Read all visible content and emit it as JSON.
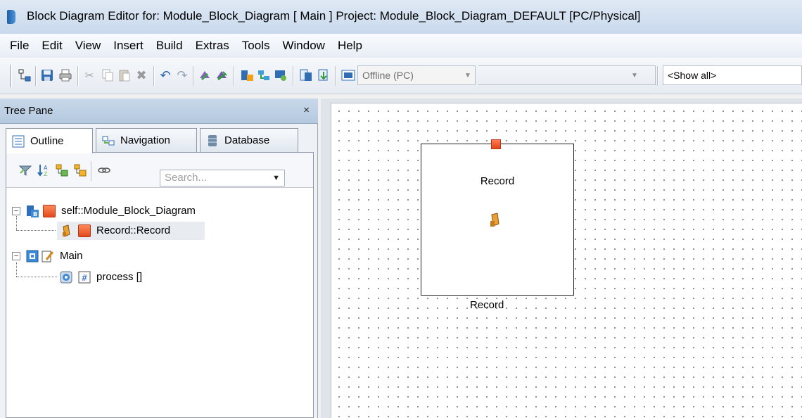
{
  "window": {
    "title": "Block Diagram Editor for: Module_Block_Diagram [ Main ] Project: Module_Block_Diagram_DEFAULT [PC/Physical]"
  },
  "menu": [
    "File",
    "Edit",
    "View",
    "Insert",
    "Build",
    "Extras",
    "Tools",
    "Window",
    "Help"
  ],
  "toolbar": {
    "mode_select": "Offline (PC)",
    "filter_select": "<Show all>"
  },
  "tree_pane": {
    "title": "Tree Pane",
    "close": "×",
    "tabs": [
      {
        "label": "Outline",
        "active": true
      },
      {
        "label": "Navigation",
        "active": false
      },
      {
        "label": "Database",
        "active": false
      }
    ],
    "search_placeholder": "Search...",
    "items": [
      {
        "label": "self::Module_Block_Diagram",
        "expander": "−"
      },
      {
        "label": "Record::Record",
        "selected": true
      },
      {
        "label": "Main",
        "expander": "−"
      },
      {
        "label": "process []"
      }
    ]
  },
  "canvas": {
    "block": {
      "title": "Record",
      "label": "Record"
    }
  },
  "colors": {
    "accent_red": "#e2451a",
    "title_bar": "#c9d9ec",
    "pane_header": "#b5c9df"
  }
}
